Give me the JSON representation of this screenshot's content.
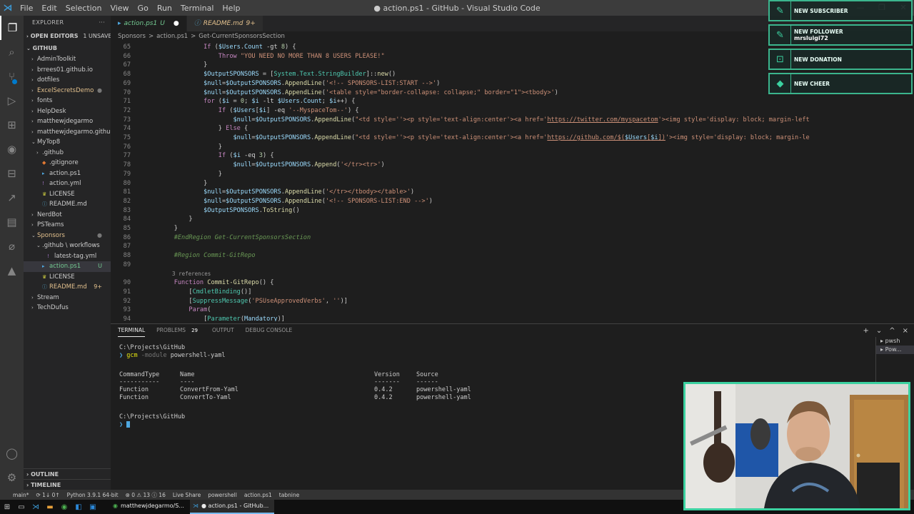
{
  "window": {
    "title": "● action.ps1 - GitHub - Visual Studio Code",
    "menu": [
      "File",
      "Edit",
      "Selection",
      "View",
      "Go",
      "Run",
      "Terminal",
      "Help"
    ]
  },
  "sidebar": {
    "header": "EXPLORER",
    "more": "···",
    "open_editors": "OPEN EDITORS",
    "unsaved": "1 UNSAVED",
    "workspace": "GITHUB",
    "items": [
      {
        "label": "AdminToolkit",
        "indent": 1,
        "folder": true
      },
      {
        "label": "brrees01.github.io",
        "indent": 1,
        "folder": true
      },
      {
        "label": "dotfiles",
        "indent": 1,
        "folder": true
      },
      {
        "label": "ExcelSecretsDemo",
        "indent": 1,
        "folder": true,
        "status": "mod"
      },
      {
        "label": "fonts",
        "indent": 1,
        "folder": true
      },
      {
        "label": "HelpDesk",
        "indent": 1,
        "folder": true
      },
      {
        "label": "matthewjdegarmo",
        "indent": 1,
        "folder": true
      },
      {
        "label": "matthewjdegarmo.githu...",
        "indent": 1,
        "folder": true
      },
      {
        "label": "MyTop8",
        "indent": 1,
        "folder": true,
        "open": true
      },
      {
        "label": ".github",
        "indent": 2,
        "folder": true
      },
      {
        "label": ".gitignore",
        "indent": 2,
        "type": "git"
      },
      {
        "label": "action.ps1",
        "indent": 2,
        "type": "ps"
      },
      {
        "label": "action.yml",
        "indent": 2,
        "type": "yml"
      },
      {
        "label": "LICENSE",
        "indent": 2,
        "type": "lic"
      },
      {
        "label": "README.md",
        "indent": 2,
        "type": "md"
      },
      {
        "label": "NerdBot",
        "indent": 1,
        "folder": true
      },
      {
        "label": "PSTeams",
        "indent": 1,
        "folder": true
      },
      {
        "label": "Sponsors",
        "indent": 1,
        "folder": true,
        "open": true,
        "status": "mod"
      },
      {
        "label": ".github \\ workflows",
        "indent": 2,
        "folder": true,
        "open": true
      },
      {
        "label": "latest-tag.yml",
        "indent": 3,
        "type": "yml"
      },
      {
        "label": "action.ps1",
        "indent": 2,
        "type": "ps",
        "status": "unt",
        "deco": "U",
        "selected": true
      },
      {
        "label": "LICENSE",
        "indent": 2,
        "type": "lic"
      },
      {
        "label": "README.md",
        "indent": 2,
        "type": "md",
        "status": "mod",
        "deco": "9+"
      },
      {
        "label": "Stream",
        "indent": 1,
        "folder": true
      },
      {
        "label": "TechDufus",
        "indent": 1,
        "folder": true
      }
    ],
    "outline": "OUTLINE",
    "timeline": "TIMELINE"
  },
  "tabs": [
    {
      "label": "action.ps1",
      "suffix": "U",
      "active": true,
      "dirty": "●"
    },
    {
      "label": "README.md",
      "suffix": "9+",
      "active": false,
      "dirty": ""
    }
  ],
  "breadcrumb": [
    "Sponsors",
    ">",
    "action.ps1",
    ">",
    "Get-CurrentSponsorsSection"
  ],
  "code": [
    {
      "n": "65",
      "html": "            <span class='k'>If</span> (<span class='v'>$Users</span>.<span class='v'>Count</span> <span class='o'>-gt</span> <span class='num'>8</span>) {"
    },
    {
      "n": "66",
      "html": "                <span class='k'>Throw</span> <span class='s'>\"YOU NEED NO MORE THAN 8 USERS PLEASE!\"</span>"
    },
    {
      "n": "67",
      "html": "            }"
    },
    {
      "n": "68",
      "html": "            <span class='v'>$OutputSPONSORS</span> = [<span class='t'>System.Text.StringBuilder</span>]::<span class='f'>new</span>()"
    },
    {
      "n": "69",
      "html": "            <span class='v'>$null</span>=<span class='v'>$OutputSPONSORS</span>.<span class='f'>AppendLine</span>(<span class='s'>'&lt;!-- SPONSORS-LIST:START --&gt;'</span>)"
    },
    {
      "n": "70",
      "html": "            <span class='v'>$null</span>=<span class='v'>$OutputSPONSORS</span>.<span class='f'>AppendLine</span>(<span class='s'>'&lt;table style=\"border-collapse: collapse;\" border=\"1\"&gt;&lt;tbody&gt;'</span>)"
    },
    {
      "n": "71",
      "html": "            <span class='k'>for</span> (<span class='v'>$i</span> = <span class='num'>0</span>; <span class='v'>$i</span> <span class='o'>-lt</span> <span class='v'>$Users</span>.<span class='v'>Count</span>; <span class='v'>$i</span>++) {"
    },
    {
      "n": "72",
      "html": "                <span class='k'>If</span> (<span class='v'>$Users</span>[<span class='v'>$i</span>] <span class='o'>-eq</span> <span class='s'>'--MyspaceTom--'</span>) {"
    },
    {
      "n": "73",
      "html": "                    <span class='v'>$null</span>=<span class='v'>$OutputSPONSORS</span>.<span class='f'>AppendLine</span>(<span class='s'>\"&lt;td style=''&gt;&lt;p style='text-align:center'&gt;&lt;a href='</span><span class='u'>https://twitter.com/myspacetom</span><span class='s'>'&gt;&lt;img style='display: block; margin-left</span>"
    },
    {
      "n": "74",
      "html": "                } <span class='k'>Else</span> {"
    },
    {
      "n": "75",
      "html": "                    <span class='v'>$null</span>=<span class='v'>$OutputSPONSORS</span>.<span class='f'>AppendLine</span>(<span class='s'>\"&lt;td style=''&gt;&lt;p style='text-align:center'&gt;&lt;a href='</span><span class='u'>https://github.com/$(<span class='v'>$Users</span>[<span class='v'>$i</span>])</span><span class='s'>'&gt;&lt;img style='display: block; margin-le</span>"
    },
    {
      "n": "76",
      "html": "                }"
    },
    {
      "n": "77",
      "html": "                <span class='k'>If</span> (<span class='v'>$i</span> <span class='o'>-eq</span> <span class='num'>3</span>) {"
    },
    {
      "n": "78",
      "html": "                    <span class='v'>$null</span>=<span class='v'>$OutputSPONSORS</span>.<span class='f'>Append</span>(<span class='s'>'&lt;/tr&gt;&lt;tr&gt;'</span>)"
    },
    {
      "n": "79",
      "html": "                }"
    },
    {
      "n": "80",
      "html": "            }"
    },
    {
      "n": "81",
      "html": "            <span class='v'>$null</span>=<span class='v'>$OutputSPONSORS</span>.<span class='f'>AppendLine</span>(<span class='s'>'&lt;/tr&gt;&lt;/tbody&gt;&lt;/table&gt;'</span>)"
    },
    {
      "n": "82",
      "html": "            <span class='v'>$null</span>=<span class='v'>$OutputSPONSORS</span>.<span class='f'>AppendLine</span>(<span class='s'>'&lt;!-- SPONSORS-LIST:END --&gt;'</span>)"
    },
    {
      "n": "83",
      "html": "            <span class='v'>$OutputSPONSORS</span>.<span class='f'>ToString</span>()"
    },
    {
      "n": "84",
      "html": "        }"
    },
    {
      "n": "85",
      "html": "    }"
    },
    {
      "n": "86",
      "html": "    <span class='c'>#EndRegion Get-CurrentSponsorsSection</span>"
    },
    {
      "n": "87",
      "html": ""
    },
    {
      "n": "88",
      "html": "    <span class='c'>#Region Commit-GitRepo</span>"
    },
    {
      "n": "89",
      "html": ""
    },
    {
      "n": "",
      "html": "    3 references",
      "ref": true
    },
    {
      "n": "90",
      "html": "    <span class='k'>Function</span> <span class='f'>Commit-GitRepo</span>() {"
    },
    {
      "n": "91",
      "html": "        [<span class='t'>CmdletBinding</span>()]"
    },
    {
      "n": "92",
      "html": "        [<span class='t'>SuppressMessage</span>(<span class='s'>'PSUseApprovedVerbs'</span>, <span class='s'>''</span>)]"
    },
    {
      "n": "93",
      "html": "        <span class='k'>Param</span>("
    },
    {
      "n": "94",
      "html": "            [<span class='t'>Parameter</span>(<span class='v'>Mandatory</span>)]"
    }
  ],
  "panel": {
    "tabs": [
      "TERMINAL",
      "PROBLEMS",
      "OUTPUT",
      "DEBUG CONSOLE"
    ],
    "problems_count": "29",
    "controls": [
      "+",
      "⌄",
      "^",
      "×"
    ],
    "terminals": [
      "pwsh",
      "Pow..."
    ]
  },
  "terminal": {
    "path1": "C:\\Projects\\GitHub",
    "cmd": "gcm",
    "param": "-module",
    "arg": "powershell-yaml",
    "headers": [
      "CommandType",
      "Name",
      "Version",
      "Source"
    ],
    "underlines": [
      "-----------",
      "----",
      "-------",
      "------"
    ],
    "rows": [
      [
        "Function",
        "ConvertFrom-Yaml",
        "0.4.2",
        "powershell-yaml"
      ],
      [
        "Function",
        "ConvertTo-Yaml",
        "0.4.2",
        "powershell-yaml"
      ]
    ],
    "path2": "C:\\Projects\\GitHub"
  },
  "statusbar": [
    "main*",
    "⟳ 1↓ 0↑",
    "Python 3.9.1 64-bit",
    "⊗ 0 ⚠ 13 ⓘ 16",
    "Live Share",
    "powershell",
    "action.ps1",
    "tabnine"
  ],
  "taskbar": {
    "apps": [
      {
        "label": "matthewjdegarmo/S...",
        "active": false
      },
      {
        "label": "● action.ps1 - GitHub...",
        "active": true
      }
    ]
  },
  "alerts": [
    {
      "title": "NEW SUBSCRIBER",
      "sub": "",
      "icon": "✎"
    },
    {
      "title": "NEW FOLLOWER",
      "sub": "mrsluigi72",
      "icon": "✎"
    },
    {
      "title": "NEW DONATION",
      "sub": "",
      "icon": "⊡"
    },
    {
      "title": "NEW CHEER",
      "sub": "",
      "icon": "◆"
    }
  ],
  "colors": {
    "accent": "#007acc",
    "overlay": "#3bd1a0"
  }
}
